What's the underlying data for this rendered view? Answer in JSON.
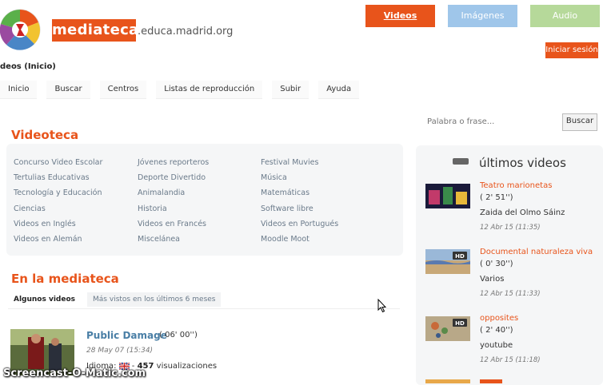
{
  "header": {
    "brand": "mediateca",
    "domain": ".educa.madrid.org",
    "buttons": {
      "videos": "Videos",
      "imagenes": "Imágenes",
      "audio": "Audio"
    },
    "login": "Iniciar sesión",
    "breadcrumb": "deos (Inicio)"
  },
  "nav": [
    "Inicio",
    "Buscar",
    "Centros",
    "Listas de reproducción",
    "Subir",
    "Ayuda"
  ],
  "search": {
    "placeholder": "Palabra o frase...",
    "button": "Buscar"
  },
  "videoteca": {
    "title": "Videoteca",
    "col1": [
      "Concurso Video Escolar",
      "Tertulias Educativas",
      "Tecnología y Educación",
      "Ciencias",
      "Videos en Inglés",
      "Videos en Alemán"
    ],
    "col2": [
      "Jóvenes reporteros",
      "Deporte Divertido",
      "Animalandia",
      "Historia",
      "Videos en Francés",
      "Miscelánea"
    ],
    "col3": [
      "Festival Muvies",
      "Música",
      "Matemáticas",
      "Software libre",
      "Videos en Portugués",
      "Moodle Moot"
    ]
  },
  "mediateca": {
    "title": "En la mediateca",
    "tabs": [
      "Algunos videos",
      "Más vistos en los últimos 6 meses"
    ],
    "featured": {
      "title": "Public Damage",
      "duration": "( 06' 00'')",
      "date": "28 May 07 (15:34)",
      "lang_label": "Idioma:",
      "views_count": "457",
      "views_label": "visualizaciones"
    }
  },
  "sidebar": {
    "title": "últimos videos",
    "items": [
      {
        "title": "Teatro marionetas",
        "duration": "( 2' 51'')",
        "author": "Zaida del Olmo Sáinz",
        "date": "12 Abr 15 (11:35)",
        "hd": false
      },
      {
        "title": "Documental naturaleza viva",
        "duration": "( 0' 30'')",
        "author": "Varios",
        "date": "12 Abr 15 (11:33)",
        "hd": true
      },
      {
        "title": "opposites",
        "duration": "( 2' 40'')",
        "author": "youtube",
        "date": "12 Abr 15 (11:18)",
        "hd": true
      }
    ]
  },
  "watermark": "Screencast-O-Matic.com",
  "colors": {
    "accent": "#e8541b",
    "imagenes": "#9fc6ea",
    "audio": "#b6d99a",
    "link": "#6a7a8a"
  }
}
